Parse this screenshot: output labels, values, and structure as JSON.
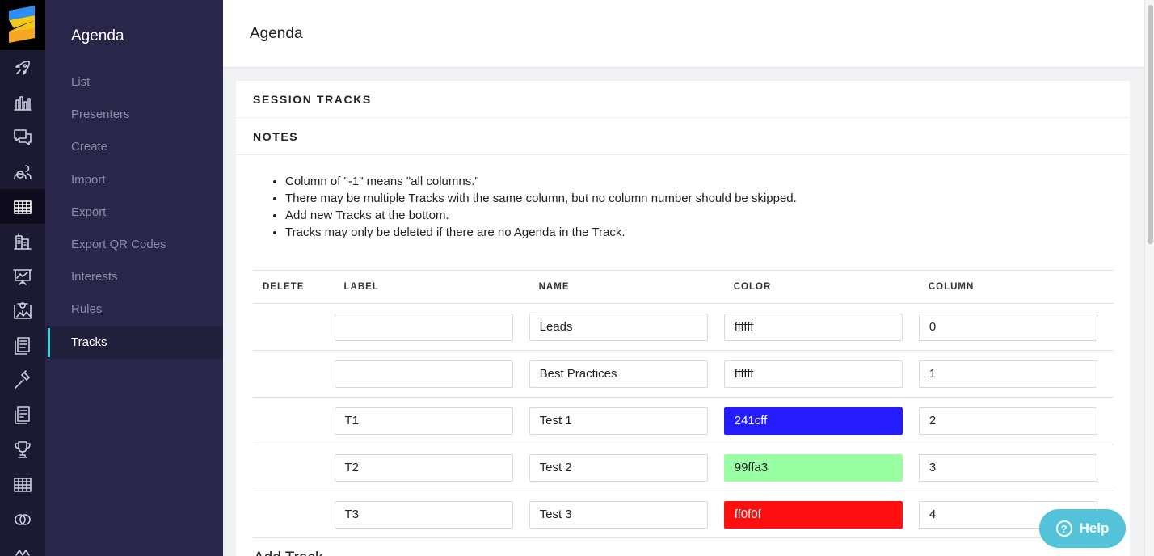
{
  "rail": {
    "items": [
      "rocket-icon",
      "bar-chart-icon",
      "chat-icon",
      "users-icon",
      "grid-calendar-icon",
      "buildings-icon",
      "presentation-icon",
      "map-icon",
      "document-icon",
      "hammer-icon",
      "clipboard-icon",
      "trophy-icon",
      "table-icon",
      "rings-icon",
      "misc-icon"
    ],
    "active_index": 4
  },
  "sidebar": {
    "title": "Agenda",
    "items": [
      {
        "label": "List"
      },
      {
        "label": "Presenters"
      },
      {
        "label": "Create"
      },
      {
        "label": "Import"
      },
      {
        "label": "Export"
      },
      {
        "label": "Export QR Codes"
      },
      {
        "label": "Interests"
      },
      {
        "label": "Rules"
      },
      {
        "label": "Tracks"
      }
    ],
    "active_label": "Tracks"
  },
  "header": {
    "title": "Agenda"
  },
  "card": {
    "title": "SESSION TRACKS",
    "notes_title": "NOTES",
    "notes": [
      "Column of \"-1\" means \"all columns.\"",
      "There may be multiple Tracks with the same column, but no column number should be skipped.",
      "Add new Tracks at the bottom.",
      "Tracks may only be deleted if there are no Agenda in the Track."
    ],
    "table": {
      "headers": [
        "DELETE",
        "LABEL",
        "NAME",
        "COLOR",
        "COLUMN"
      ],
      "rows": [
        {
          "label": "",
          "name": "Leads",
          "color": "ffffff",
          "column": "0"
        },
        {
          "label": "",
          "name": "Best Practices",
          "color": "ffffff",
          "column": "1"
        },
        {
          "label": "T1",
          "name": "Test 1",
          "color": "241cff",
          "column": "2"
        },
        {
          "label": "T2",
          "name": "Test 2",
          "color": "99ffa3",
          "column": "3"
        },
        {
          "label": "T3",
          "name": "Test 3",
          "color": "ff0f0f",
          "column": "4"
        }
      ]
    },
    "add_track": "Add Track"
  },
  "help": {
    "label": "Help",
    "icon": "question-icon",
    "color": "#54c2d8"
  },
  "colors": {
    "rail": "#1c1932",
    "sidebar": "#29264a",
    "accent": "#3fd2e0"
  }
}
